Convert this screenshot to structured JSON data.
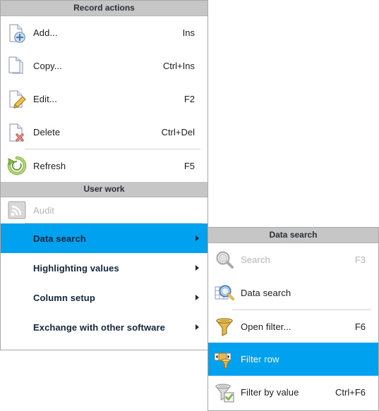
{
  "main_menu": {
    "header": "Record actions",
    "items": [
      {
        "label": "Add...",
        "accel": "Ins",
        "icon": "document-add-icon",
        "state": "normal"
      },
      {
        "label": "Copy...",
        "accel": "Ctrl+Ins",
        "icon": "document-copy-icon",
        "state": "normal"
      },
      {
        "label": "Edit...",
        "accel": "F2",
        "icon": "document-edit-icon",
        "state": "normal"
      },
      {
        "label": "Delete",
        "accel": "Ctrl+Del",
        "icon": "document-delete-icon",
        "state": "normal"
      },
      {
        "label": "Refresh",
        "accel": "F5",
        "icon": "refresh-icon",
        "state": "normal"
      }
    ]
  },
  "user_work": {
    "header": "User work",
    "items": [
      {
        "label": "Audit",
        "accel": "",
        "icon": "rss-signal-icon",
        "state": "disabled",
        "submenu": false
      },
      {
        "label": "Data search",
        "accel": "",
        "icon": "none",
        "state": "selected",
        "submenu": true
      },
      {
        "label": "Highlighting values",
        "accel": "",
        "icon": "none",
        "state": "normal",
        "submenu": true
      },
      {
        "label": "Column setup",
        "accel": "",
        "icon": "none",
        "state": "normal",
        "submenu": true
      },
      {
        "label": "Exchange with other software",
        "accel": "",
        "icon": "none",
        "state": "normal",
        "submenu": true
      }
    ]
  },
  "sub_menu": {
    "header": "Data search",
    "items": [
      {
        "label": "Search",
        "accel": "F3",
        "icon": "magnifier-icon",
        "state": "disabled"
      },
      {
        "label": "Data search",
        "accel": "",
        "icon": "grid-magnifier-icon",
        "state": "normal"
      },
      {
        "label": "Open filter...",
        "accel": "F6",
        "icon": "gold-funnel-icon",
        "state": "normal"
      },
      {
        "label": "Filter row",
        "accel": "",
        "icon": "filter-row-icon",
        "state": "selected"
      },
      {
        "label": "Filter by value",
        "accel": "Ctrl+F6",
        "icon": "funnel-check-icon",
        "state": "normal"
      }
    ]
  },
  "colors": {
    "highlight": "#00a2f0",
    "header_bg": "#c6c6c6",
    "panel_border": "#a8a8a8",
    "text": "#1c1c1c",
    "disabled_text": "#b5b5b5"
  }
}
